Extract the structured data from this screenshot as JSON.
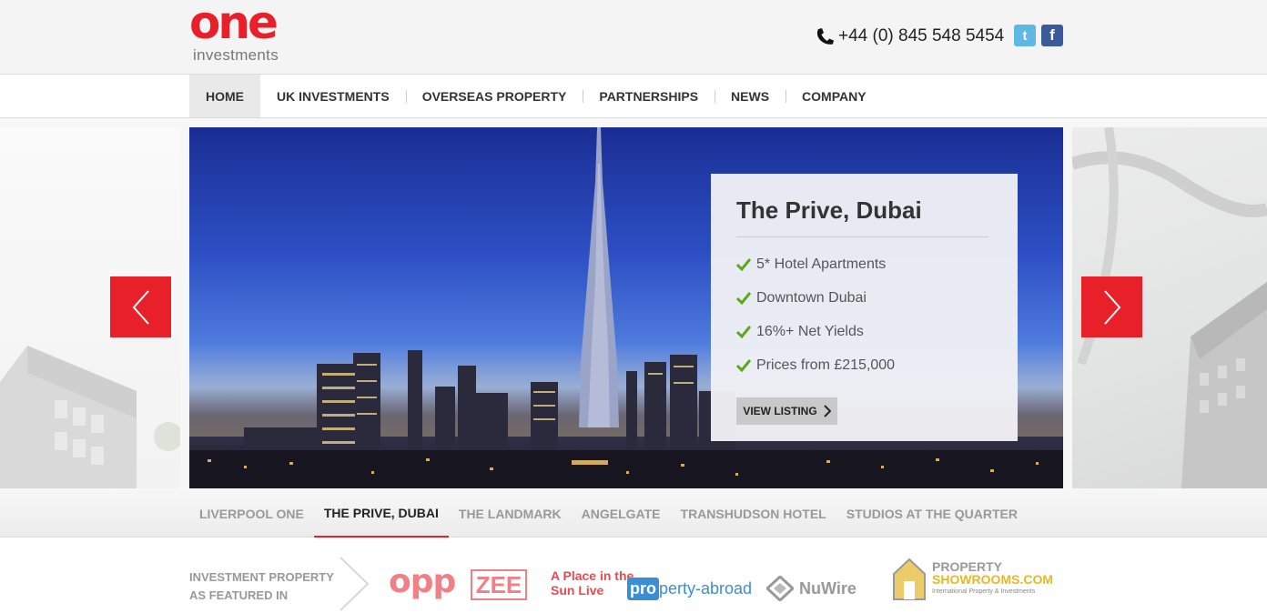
{
  "header": {
    "logo_main": "one",
    "logo_sub": "investments",
    "phone": "+44 (0) 845 548 5454",
    "social": [
      {
        "name": "twitter",
        "glyph": "t"
      },
      {
        "name": "facebook",
        "glyph": "f"
      }
    ]
  },
  "nav": {
    "items": [
      {
        "label": "HOME",
        "active": true
      },
      {
        "label": "UK INVESTMENTS"
      },
      {
        "label": "OVERSEAS PROPERTY"
      },
      {
        "label": "PARTNERSHIPS"
      },
      {
        "label": "NEWS"
      },
      {
        "label": "COMPANY"
      }
    ]
  },
  "slide": {
    "title": "The Prive, Dubai",
    "features": [
      "5* Hotel Apartments",
      "Downtown Dubai",
      "16%+ Net Yields",
      "Prices from £215,000"
    ],
    "button": "VIEW LISTING"
  },
  "tabs": {
    "items": [
      {
        "label": "LIVERPOOL ONE"
      },
      {
        "label": "THE PRIVE, DUBAI",
        "active": true
      },
      {
        "label": "THE LANDMARK"
      },
      {
        "label": "ANGELGATE"
      },
      {
        "label": "TRANSHUDSON HOTEL"
      },
      {
        "label": "STUDIOS AT THE QUARTER"
      }
    ]
  },
  "featured": {
    "label_line1": "INVESTMENT PROPERTY",
    "label_line2": "AS FEATURED IN",
    "logos": {
      "opp": "opp",
      "zee": "ZEE",
      "apis_line1": "A Place in the",
      "apis_line2": "Sun Live",
      "pa_box": "pro",
      "pa_rest": "perty-abroad",
      "nuwire": "NuWire",
      "ps_line1": "PROPERTY",
      "ps_line2": "SHOWROOMS.COM",
      "ps_line3": "International Property & Investments"
    }
  },
  "colors": {
    "brand_red": "#e8202a",
    "twitter": "#5fb7e6",
    "facebook": "#3b5a99",
    "check_green": "#5aa81e"
  }
}
